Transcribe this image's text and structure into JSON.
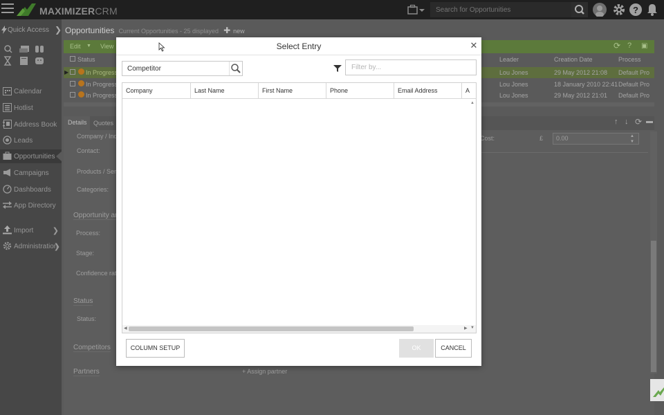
{
  "app": {
    "logo_text": "MAXIMIZER",
    "logo_suffix": "CRM",
    "search_placeholder": "Search for Opportunities"
  },
  "sidebar": {
    "quick_access": "Quick Access",
    "items": [
      {
        "label": "Calendar",
        "icon": "calendar-icon"
      },
      {
        "label": "Hotlist",
        "icon": "hotlist-icon"
      },
      {
        "label": "Address Book",
        "icon": "address-book-icon"
      },
      {
        "label": "Leads",
        "icon": "leads-icon"
      },
      {
        "label": "Opportunities",
        "icon": "opportunities-icon"
      },
      {
        "label": "Campaigns",
        "icon": "campaigns-icon"
      },
      {
        "label": "Dashboards",
        "icon": "dashboards-icon"
      },
      {
        "label": "App Directory",
        "icon": "app-directory-icon"
      },
      {
        "label": "Import",
        "icon": "import-icon"
      },
      {
        "label": "Administration",
        "icon": "administration-icon"
      }
    ]
  },
  "page": {
    "title": "Opportunities",
    "subtitle": "Current Opportunities - 25 displayed",
    "new_label": "new"
  },
  "toolbar": {
    "edit": "Edit",
    "view": "View"
  },
  "background_grid": {
    "columns": [
      "Status",
      "Leader",
      "Creation Date",
      "Process"
    ],
    "rows": [
      {
        "status": "In Progress",
        "leader": "Lou Jones",
        "date": "29 May 2012 21:08",
        "process": "Default Pro"
      },
      {
        "status": "In Progress",
        "leader": "Lou Jones",
        "date": "18 January 2010 22:41",
        "process": "Default Pro"
      },
      {
        "status": "In Progress",
        "leader": "Lou Jones",
        "date": "29 May 2012 21:01",
        "process": "Default Pro"
      }
    ]
  },
  "detail": {
    "tabs": [
      "Details",
      "Quotes"
    ],
    "fields": [
      "Company / Indi",
      "Contact:",
      "Products / Serv",
      "Categories:",
      "Process:",
      "Stage:",
      "Confidence rati",
      "Status:"
    ],
    "sections": [
      "Opportunity an",
      "Status",
      "Competitors",
      "Partners"
    ],
    "assign_partner": "+ Assign partner",
    "cost_label": "Cost:",
    "currency": "£",
    "cost_value": "0.00"
  },
  "dialog": {
    "title": "Select Entry",
    "entity_value": "Competitor",
    "filter_placeholder": "Filter by...",
    "columns": [
      "Company",
      "Last Name",
      "First Name",
      "Phone",
      "Email Address",
      "A"
    ],
    "column_setup": "COLUMN SETUP",
    "ok": "OK",
    "cancel": "CANCEL"
  },
  "colors": {
    "brand_green": "#6aa84f",
    "selected_row": "#5e6e3e",
    "ok_disabled": "#e1e1e1"
  }
}
